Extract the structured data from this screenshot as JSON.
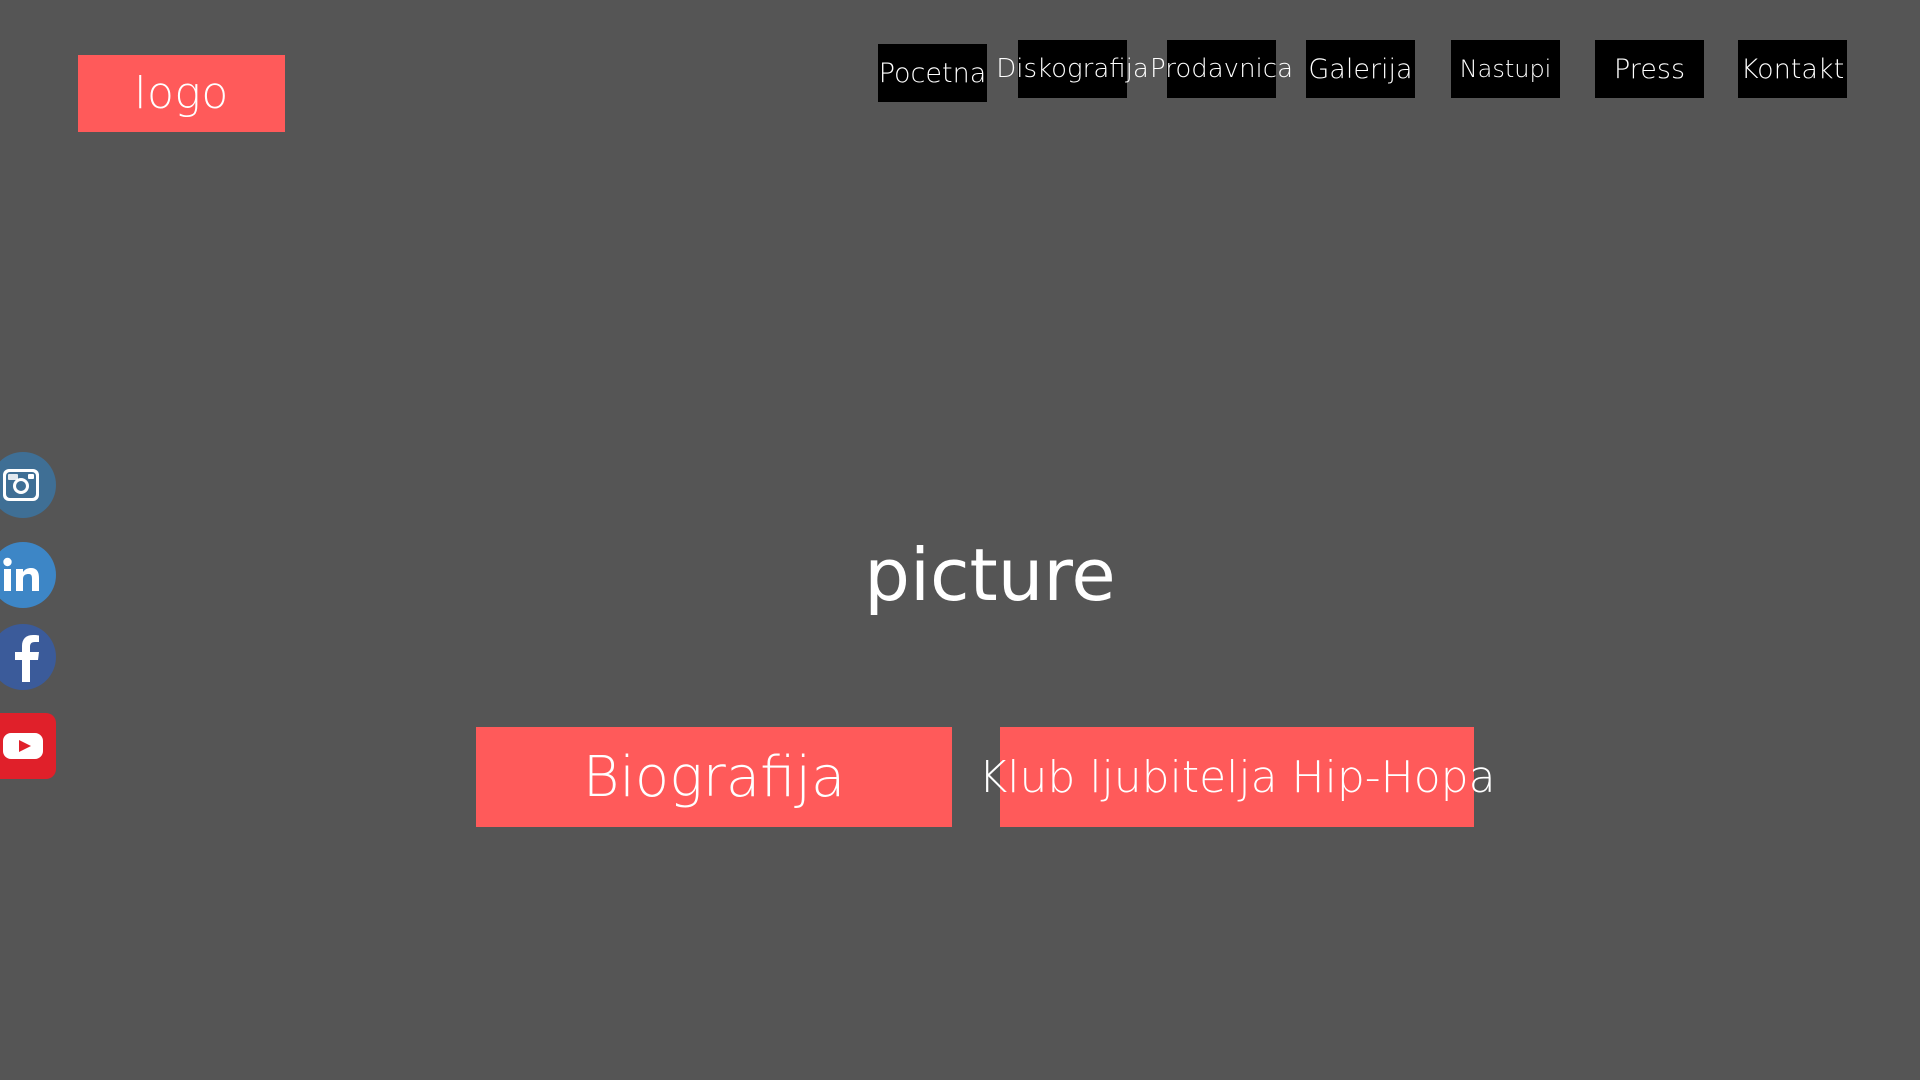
{
  "header": {
    "logo_label": "logo"
  },
  "nav": {
    "items": [
      {
        "label": "Pocetna"
      },
      {
        "label": "Diskografija"
      },
      {
        "label": "Prodavnica"
      },
      {
        "label": "Galerija"
      },
      {
        "label": "Nastupi"
      },
      {
        "label": "Press"
      },
      {
        "label": "Kontakt"
      }
    ]
  },
  "hero": {
    "text": "picture"
  },
  "cta": {
    "biography_label": "Biografija",
    "club_label": "Klub ljubitelja Hip-Hopa"
  },
  "social": {
    "icons": [
      {
        "name": "instagram-icon",
        "color": "#3f6f95"
      },
      {
        "name": "linkedin-icon",
        "color": "#3d86c6"
      },
      {
        "name": "facebook-icon",
        "color": "#3b5b9a"
      },
      {
        "name": "youtube-icon",
        "color": "#e0202a"
      }
    ]
  },
  "colors": {
    "background": "#555555",
    "accent": "#ff5a5a",
    "nav_bg": "#000000",
    "text": "#ffffff"
  }
}
